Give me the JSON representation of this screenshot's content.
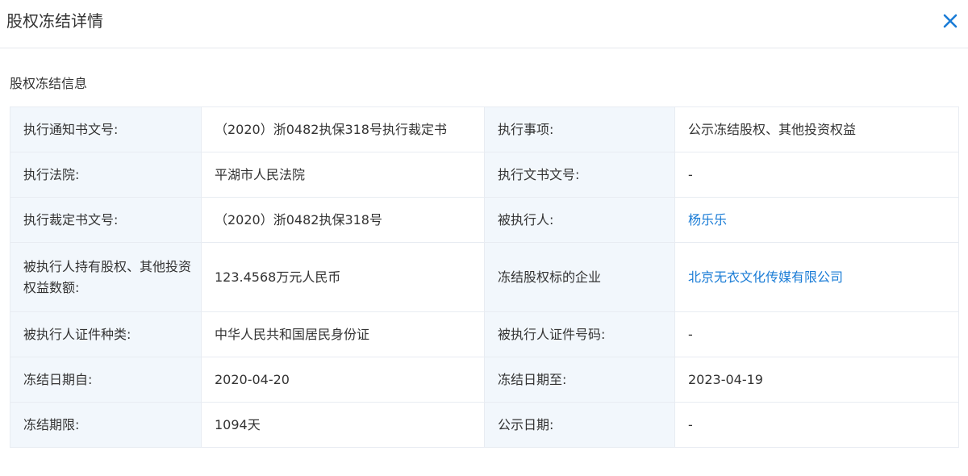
{
  "header": {
    "title": "股权冻结详情",
    "close_icon": "close-icon",
    "accent_color": "#1a7cd6"
  },
  "section": {
    "title": "股权冻结信息"
  },
  "table": {
    "rows": [
      [
        {
          "label": "执行通知书文号:",
          "value": "（2020）浙0482执保318号执行裁定书"
        },
        {
          "label": "执行事项:",
          "value": "公示冻结股权、其他投资权益"
        }
      ],
      [
        {
          "label": "执行法院:",
          "value": "平湖市人民法院"
        },
        {
          "label": "执行文书文号:",
          "value": "-"
        }
      ],
      [
        {
          "label": "执行裁定书文号:",
          "value": "（2020）浙0482执保318号"
        },
        {
          "label": "被执行人:",
          "value": "杨乐乐"
        }
      ],
      [
        {
          "label": "被执行人持有股权、其他投资权益数额:",
          "value": "123.4568万元人民币"
        },
        {
          "label": "冻结股权标的企业",
          "value": "北京无衣文化传媒有限公司"
        }
      ],
      [
        {
          "label": "被执行人证件种类:",
          "value": "中华人民共和国居民身份证"
        },
        {
          "label": "被执行人证件号码:",
          "value": "-"
        }
      ],
      [
        {
          "label": "冻结日期自:",
          "value": "2020-04-20"
        },
        {
          "label": "冻结日期至:",
          "value": "2023-04-19"
        }
      ],
      [
        {
          "label": "冻结期限:",
          "value": "1094天"
        },
        {
          "label": "公示日期:",
          "value": "-"
        }
      ]
    ]
  }
}
